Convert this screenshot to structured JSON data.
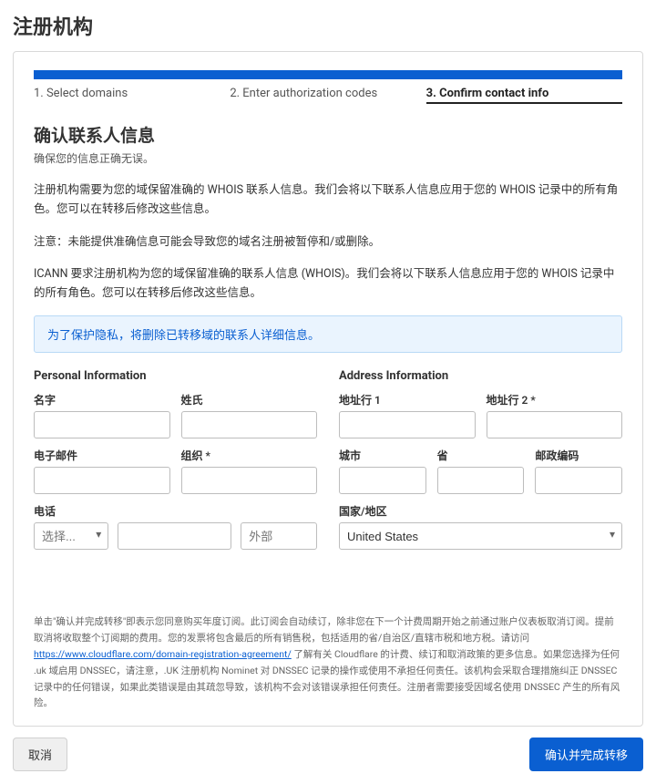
{
  "title": "注册机构",
  "steps": [
    {
      "label": "1. Select domains"
    },
    {
      "label": "2. Enter authorization codes"
    },
    {
      "label": "3. Confirm contact info"
    }
  ],
  "heading": "确认联系人信息",
  "heading_sub": "确保您的信息正确无误。",
  "para1": "注册机构需要为您的域保留准确的 WHOIS 联系人信息。我们会将以下联系人信息应用于您的 WHOIS 记录中的所有角色。您可以在转移后修改这些信息。",
  "para2": "注意：未能提供准确信息可能会导致您的域名注册被暂停和/或删除。",
  "para3": "ICANN 要求注册机构为您的域保留准确的联系人信息 (WHOIS)。我们会将以下联系人信息应用于您的 WHOIS 记录中的所有角色。您可以在转移后修改这些信息。",
  "info": "为了保护隐私，将删除已转移域的联系人详细信息。",
  "personal": {
    "title": "Personal Information",
    "first_name": "名字",
    "last_name": "姓氏",
    "email": "电子邮件",
    "org": "组织 *",
    "phone": "电话",
    "phone_prefix_placeholder": "选择...",
    "phone_ext_placeholder": "外部"
  },
  "address": {
    "title": "Address Information",
    "line1": "地址行 1",
    "line2": "地址行 2 *",
    "city": "城市",
    "state": "省",
    "postal": "邮政编码",
    "country": "国家/地区",
    "country_value": "United States"
  },
  "legal_pre": "单击\"确认并完成转移\"即表示您同意购买年度订阅。此订阅会自动续订，除非您在下一个计费周期开始之前通过账户仪表板取消订阅。提前取消将收取整个订阅期的费用。您的发票将包含最后的所有销售税，包括适用的省/自治区/直辖市税和地方税。请访问 ",
  "legal_link_text": "https://www.cloudflare.com/domain-registration-agreement/",
  "legal_post": " 了解有关 Cloudflare 的计费、续订和取消政策的更多信息。如果您选择为任何 .uk 域启用 DNSSEC，请注意，.UK 注册机构 Nominet 对 DNSSEC 记录的操作或使用不承担任何责任。该机构会采取合理措施纠正 DNSSEC 记录中的任何错误，如果此类错误是由其疏忽导致，该机构不会对该错误承担任何责任。注册者需要接受因域名使用 DNSSEC 产生的所有风险。",
  "buttons": {
    "cancel": "取消",
    "primary": "确认并完成转移"
  }
}
